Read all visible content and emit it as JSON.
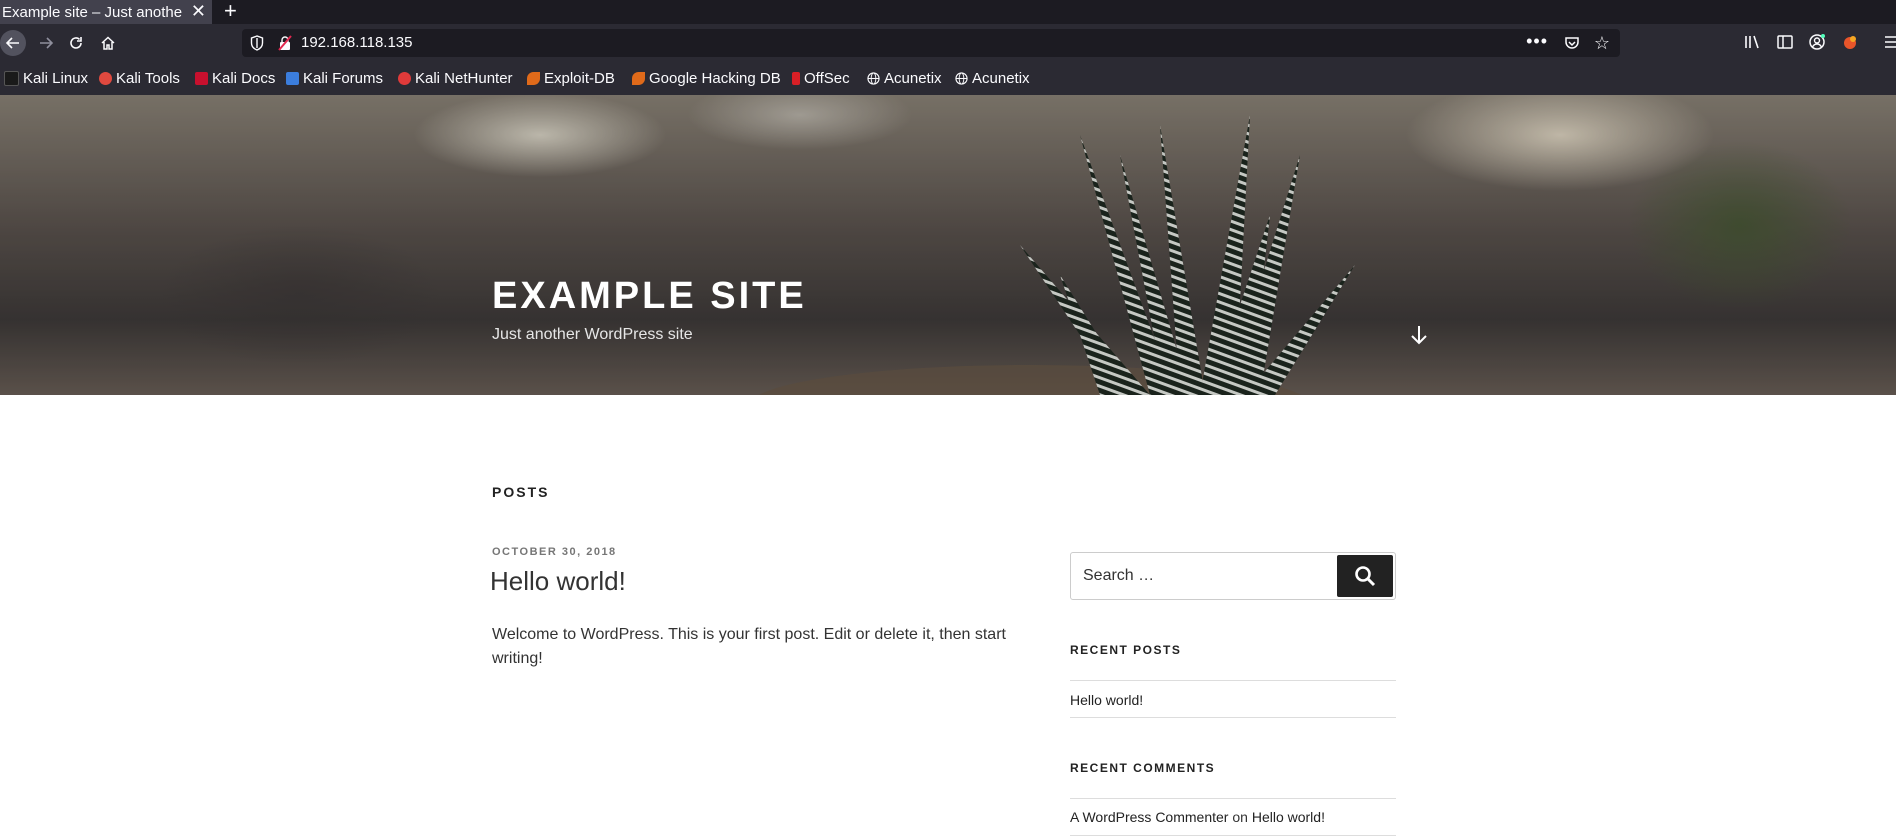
{
  "browser": {
    "tab_title": "Example site – Just another",
    "url": "192.168.118.135",
    "bookmarks": [
      {
        "label": "Kali Linux",
        "color": "#1a1a1a"
      },
      {
        "label": "Kali Tools",
        "color": "#e0493f"
      },
      {
        "label": "Kali Docs",
        "color": "#c8102e"
      },
      {
        "label": "Kali Forums",
        "color": "#3b7ddd"
      },
      {
        "label": "Kali NetHunter",
        "color": "#e03a3a"
      },
      {
        "label": "Exploit-DB",
        "color": "#e06a1a"
      },
      {
        "label": "Google Hacking DB",
        "color": "#e06a1a"
      },
      {
        "label": "OffSec",
        "color": "#d81f26"
      },
      {
        "label": "Acunetix",
        "color": "#fbfbfe"
      },
      {
        "label": "Acunetix",
        "color": "#fbfbfe"
      }
    ]
  },
  "site": {
    "title": "EXAMPLE SITE",
    "tagline": "Just another WordPress site"
  },
  "main": {
    "section_heading": "POSTS",
    "post": {
      "date": "OCTOBER 30, 2018",
      "title": "Hello world!",
      "excerpt": "Welcome to WordPress. This is your first post. Edit or delete it, then start writing!"
    }
  },
  "sidebar": {
    "search_placeholder": "Search …",
    "recent_posts_title": "RECENT POSTS",
    "recent_posts": [
      "Hello world!"
    ],
    "recent_comments_title": "RECENT COMMENTS",
    "recent_comment": {
      "author": "A WordPress Commenter",
      "connector": "on",
      "post": "Hello world!"
    }
  },
  "colors": {
    "chrome_dark": "#1c1b22",
    "chrome": "#2b2a33",
    "search_button": "#222222"
  }
}
